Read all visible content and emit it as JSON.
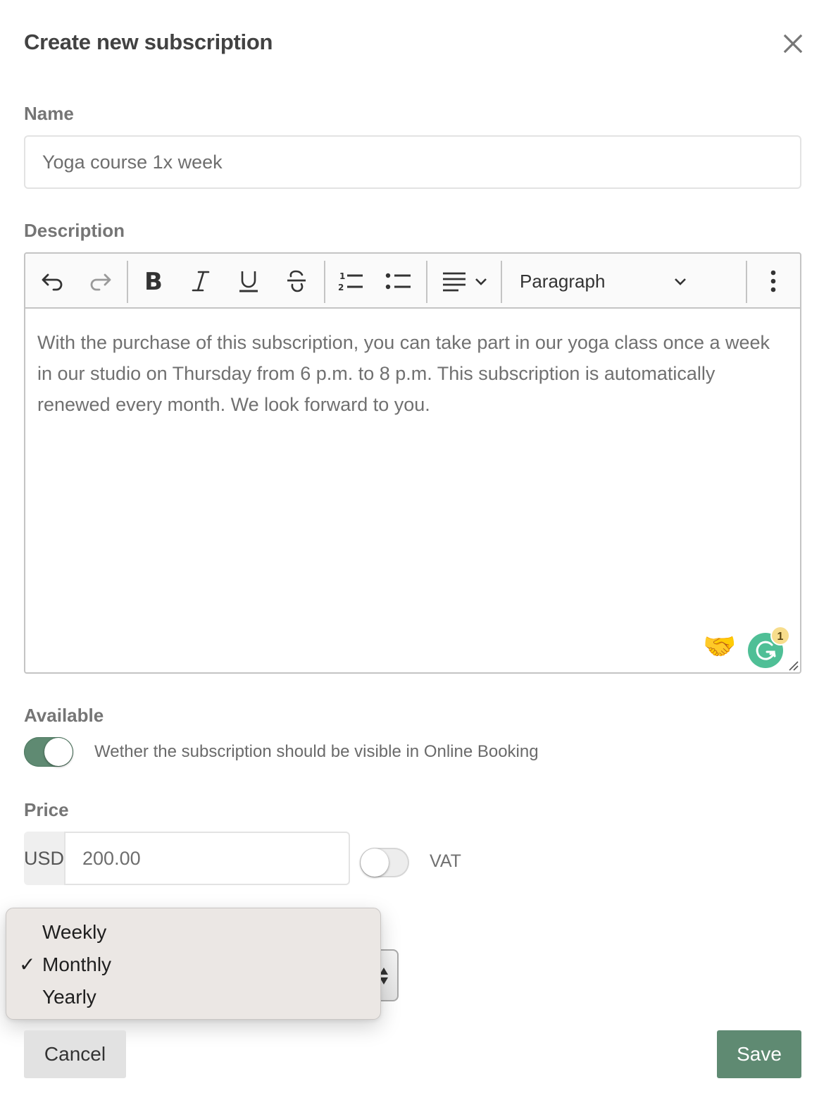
{
  "dialog": {
    "title": "Create new subscription",
    "close_icon": "close-icon"
  },
  "name_field": {
    "label": "Name",
    "value": "Yoga course 1x week"
  },
  "description_field": {
    "label": "Description",
    "toolbar": {
      "undo": "undo-icon",
      "redo": "redo-icon",
      "bold": "bold-icon",
      "italic": "italic-icon",
      "underline": "underline-icon",
      "strikethrough": "strikethrough-icon",
      "numbered_list": "numbered-list-icon",
      "bulleted_list": "bulleted-list-icon",
      "align": "align-left-icon",
      "block_format": "Paragraph",
      "more": "more-vertical-icon"
    },
    "content": "With the purchase of this subscription, you can take part in our yoga class once a week in our studio on Thursday from 6 p.m. to 8 p.m. This subscription is automatically renewed every month. We look forward to you.",
    "extensions": {
      "handshake_emoji": "🤝",
      "grammarly_badge_count": "1"
    }
  },
  "available_field": {
    "label": "Available",
    "enabled": true,
    "help_text": "Wether the subscription should be visible in Online Booking"
  },
  "price_field": {
    "label": "Price",
    "currency": "USD",
    "value": "200.00",
    "vat_label": "VAT",
    "vat_enabled": false
  },
  "billing_period": {
    "selected": "Monthly",
    "options": [
      {
        "label": "Weekly",
        "checked": false
      },
      {
        "label": "Monthly",
        "checked": true
      },
      {
        "label": "Yearly",
        "checked": false
      }
    ],
    "check_mark": "✓"
  },
  "actions": {
    "cancel": "Cancel",
    "save": "Save"
  },
  "colors": {
    "accent": "#5f8a72",
    "cancel_bg": "#e2e2e2",
    "dropdown_bg": "#ebe7e4"
  }
}
